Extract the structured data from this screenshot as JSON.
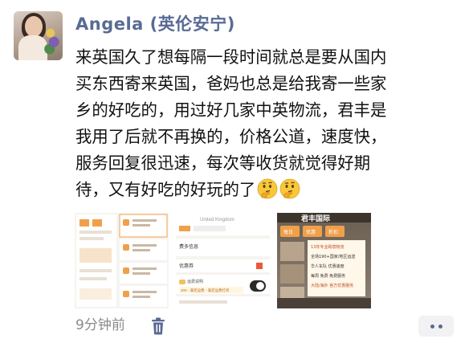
{
  "post": {
    "author_name": "Angela (英伦安宁)",
    "message_lines": [
      "来英国久了想每隔一段时间就总是要从国内",
      "买东西寄来英国，爸妈也总是给我寄一些家",
      "乡的好吃的，用过好几家中英物流，君丰是",
      "我用了后就不再换的，价格公道，速度快，",
      "服务回复很迅速，每次等收货就觉得好期",
      "待，又有好吃的好玩的了"
    ],
    "emojis": [
      "thinking-face",
      "thinking-face"
    ],
    "time": "9分钟前"
  },
  "photo2": {
    "header_text": "United Kingdom",
    "rows": [
      "费多信息",
      "优惠券",
      "运费说明"
    ],
    "bottom_text": "300 - 满足运费 - 满足运费打折"
  },
  "photo3": {
    "banner": "君丰国际",
    "cards": [
      "每日",
      "优惠",
      "折扣"
    ],
    "lines": [
      "13年专业跨境物流",
      "全场190+国家/地区运送",
      "华人车队 优惠速度",
      "每周 免费 免费服务",
      "大陆/海外 官方优惠服务"
    ]
  },
  "colors": {
    "name": "#586b94",
    "time": "#8a8a8a",
    "text": "#111111",
    "more_bg": "#f2f2f4"
  }
}
